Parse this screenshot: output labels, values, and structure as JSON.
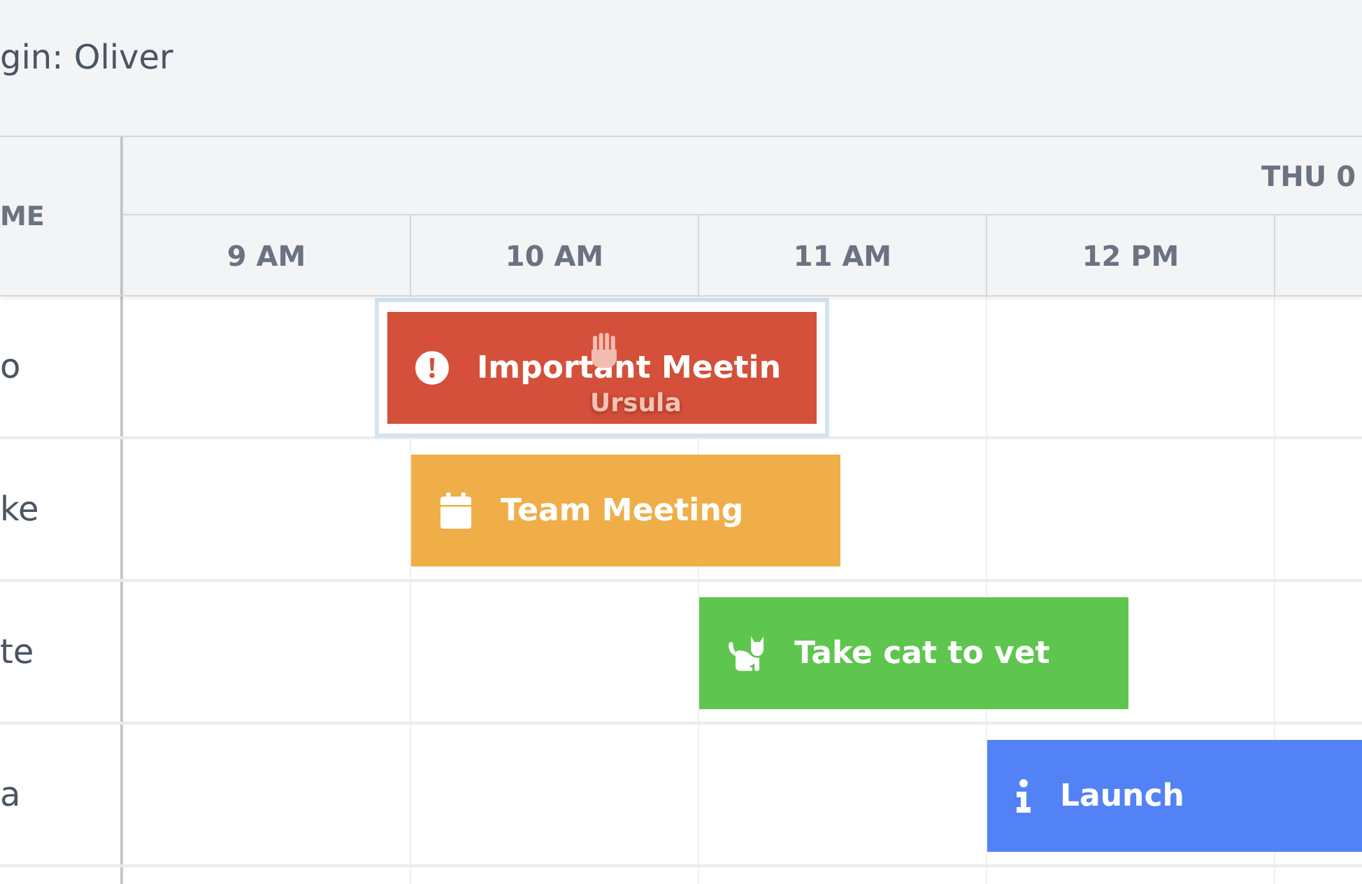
{
  "top_bar": {
    "login_text": "gin: Oliver"
  },
  "scheduler": {
    "name_heading": "ME",
    "date_heading": "THU 0",
    "time_columns": [
      "9 AM",
      "10 AM",
      "11 AM",
      "12 PM"
    ],
    "rows": [
      {
        "name": "o",
        "events": [
          {
            "title": "Important Meetin",
            "kind": "exclamation",
            "color": "#d4503a",
            "selected": true,
            "drag_label": "Ursula"
          }
        ]
      },
      {
        "name": "ke",
        "events": [
          {
            "title": "Team Meeting",
            "kind": "calendar",
            "color": "#efae47",
            "selected": false
          }
        ]
      },
      {
        "name": "te",
        "events": [
          {
            "title": "Take cat to vet",
            "kind": "cat",
            "color": "#5ec64e",
            "selected": false
          }
        ]
      },
      {
        "name": "a",
        "events": [
          {
            "title": "Launch",
            "kind": "info",
            "color": "#5282f6",
            "selected": false
          }
        ]
      }
    ]
  }
}
